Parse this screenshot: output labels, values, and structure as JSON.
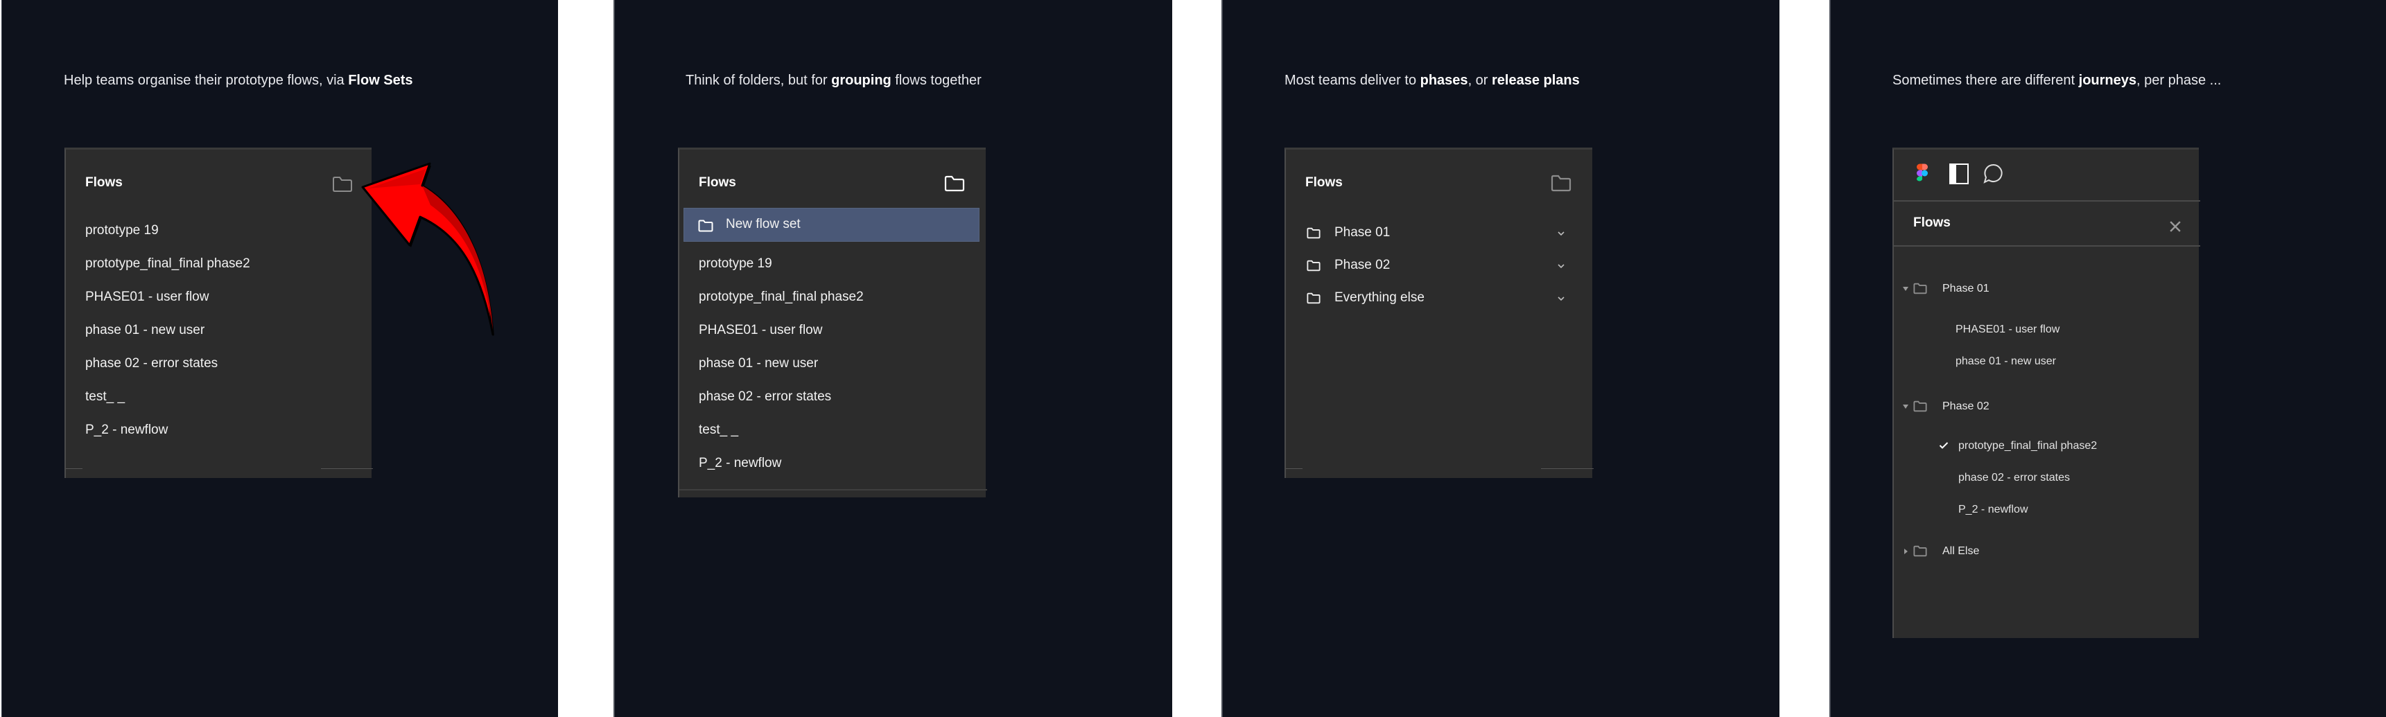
{
  "panels": [
    {
      "caption": {
        "prefix": "Help teams organise their prototype flows, via ",
        "bold": "Flow Sets",
        "suffix": ""
      },
      "card": {
        "title": "Flows",
        "header_icon": "folder-icon",
        "items": [
          "prototype 19",
          "prototype_final_final phase2",
          "PHASE01 - user flow",
          "phase 01 - new user",
          "phase 02 - error states",
          "test_ _",
          "P_2 - newflow"
        ]
      },
      "annotation": {
        "icon": "curved-arrow-icon",
        "color": "#ff0000"
      }
    },
    {
      "caption": {
        "prefix": "Think of folders, but for ",
        "bold": "grouping",
        "suffix": " flows together"
      },
      "card": {
        "title": "Flows",
        "header_icon": "folder-icon",
        "selected_item": {
          "label": "New flow set",
          "icon": "folder-icon",
          "highlight_color": "#4a5877"
        },
        "items": [
          "prototype 19",
          "prototype_final_final phase2",
          "PHASE01 - user flow",
          "phase 01 - new user",
          "phase 02 - error states",
          "test_ _",
          "P_2 - newflow"
        ]
      }
    },
    {
      "caption": {
        "prefix": "Most teams deliver to ",
        "bold": "phases",
        "middle": ", or ",
        "bold2": "release plans",
        "suffix": ""
      },
      "card": {
        "title": "Flows",
        "header_icon": "folder-icon",
        "folders": [
          {
            "label": "Phase 01",
            "icon": "folder-icon",
            "toggle_icon": "chevron-down-icon"
          },
          {
            "label": "Phase 02",
            "icon": "folder-icon",
            "toggle_icon": "chevron-down-icon"
          },
          {
            "label": "Everything else",
            "icon": "folder-icon",
            "toggle_icon": "chevron-down-icon"
          }
        ]
      }
    },
    {
      "caption": {
        "prefix": "Sometimes there are different ",
        "bold": "journeys",
        "suffix": ", per phase ..."
      },
      "card": {
        "toolbar_icons": [
          "figma-logo-icon",
          "sidebar-panel-icon",
          "comment-icon"
        ],
        "title": "Flows",
        "close_icon": "close-icon",
        "tree": [
          {
            "label": "Phase 01",
            "expanded": true,
            "children": [
              {
                "label": "PHASE01 - user flow",
                "checked": false
              },
              {
                "label": "phase 01 - new user",
                "checked": false
              }
            ]
          },
          {
            "label": "Phase 02",
            "expanded": true,
            "children": [
              {
                "label": "prototype_final_final phase2",
                "checked": true
              },
              {
                "label": "phase 02 - error states",
                "checked": false
              },
              {
                "label": "P_2 - newflow",
                "checked": false
              }
            ]
          },
          {
            "label": "All Else",
            "expanded": false,
            "children": []
          }
        ]
      }
    }
  ],
  "colors": {
    "panel_background": "#0e121c",
    "card_background": "#2c2c2c",
    "selection": "#4a5877",
    "arrow": "#ff0000"
  }
}
